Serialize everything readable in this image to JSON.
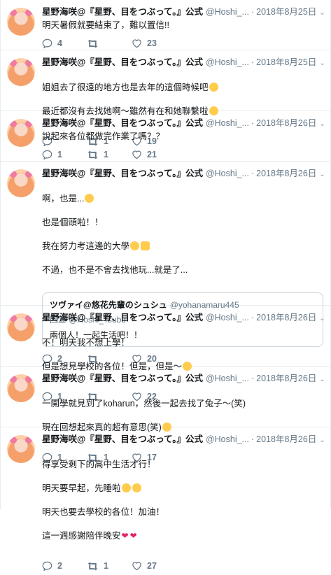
{
  "tweets": [
    {
      "name": "星野海咲@『星野、目をつぶって。』公式",
      "handle": "@Hoshi_...",
      "time": "2018年8月25日",
      "lines": [
        "明天暑假就要結束了，難以置信!!"
      ],
      "reply_count": "4",
      "retweet_count": "",
      "like_count": "23"
    },
    {
      "name": "星野海咲@『星野、目をつぶって。』公式",
      "handle": "@Hoshi_...",
      "time": "2018年8月25日",
      "lines": [
        "姐姐去了很遠的地方也是去年的這個時候吧",
        "最近都沒有去找她啊〜雖然有在和她聯繫啦"
      ],
      "reply_count": "",
      "retweet_count": "1",
      "like_count": "19"
    },
    {
      "name": "星野海咲@『星野、目をつぶって。』公式",
      "handle": "@Hoshi_...",
      "time": "2018年8月26日",
      "lines": [
        "說起來各位都做完作業了嗎？？"
      ],
      "reply_count": "1",
      "retweet_count": "1",
      "like_count": "21"
    },
    {
      "name": "星野海咲@『星野、目をつぶって。』公式",
      "handle": "@Hoshi_...",
      "time": "2018年8月26日",
      "lines": [
        "啊，也是...",
        "也是個頭啦！！",
        "我在努力考這邊的大學",
        "不過，也不是不會去找他玩...就是了..."
      ],
      "quote": {
        "name": "ツヴァイ@悠花先輩のシュシュ",
        "handle": "@yohanamaru445",
        "reply_label": "回复",
        "reply_to": "@Hoshi_Tsubu",
        "text": "兩個人！一起生活吧！！"
      },
      "reply_count": "2",
      "retweet_count": "",
      "like_count": "20"
    },
    {
      "name": "星野海咲@『星野、目をつぶって。』公式",
      "handle": "@Hoshi_...",
      "time": "2018年8月26日",
      "lines": [
        "不！明天我不想上學！",
        "但是想見學校的各位！但是，但是〜"
      ],
      "reply_count": "1",
      "retweet_count": "",
      "like_count": "22"
    },
    {
      "name": "星野海咲@『星野、目をつぶって。』公式",
      "handle": "@Hoshi_...",
      "time": "2018年8月26日",
      "lines": [
        "一開學就見到了koharun，然後一起去找了兔子〜(笑)",
        "現在回想起來真的超有意思(笑)"
      ],
      "reply_count": "1",
      "retweet_count": "1",
      "like_count": "17"
    },
    {
      "name": "星野海咲@『星野、目をつぶって。』公式",
      "handle": "@Hoshi_...",
      "time": "2018年8月26日",
      "lines": [
        "得享受剩下的高中生活才行！",
        "明天要早起，先睡啦",
        "明天也要去學校的各位！加油！",
        "這一週感謝陪伴晚安"
      ],
      "reply_count": "2",
      "retweet_count": "1",
      "like_count": "27"
    }
  ],
  "dot": "·",
  "chevron": "⌄"
}
